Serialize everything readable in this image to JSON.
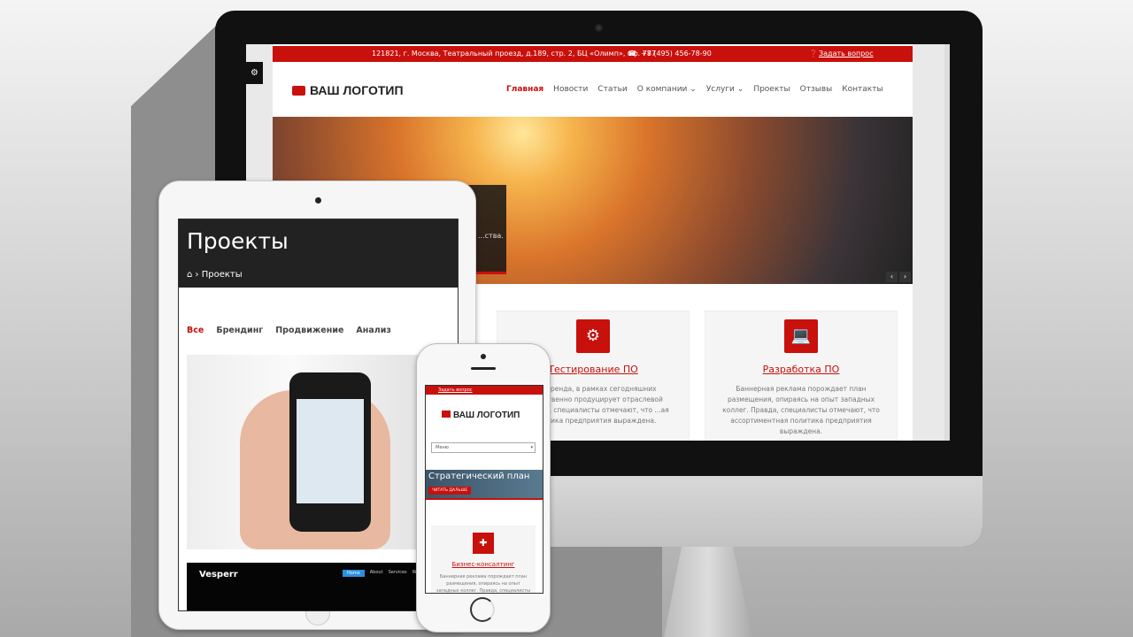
{
  "desktop": {
    "topbar": {
      "address": "121821, г. Москва, Театральный проезд, д.189, стр. 2, БЦ «Олимп», оф. 787",
      "phone": "+7 (495) 456-78-90",
      "ask": "Задать вопрос"
    },
    "logo": "ВАШ ЛОГОТИП",
    "nav": [
      "Главная",
      "Новости",
      "Статьи",
      "О компании ⌄",
      "Услуги ⌄",
      "Проекты",
      "Отзывы",
      "Контакты"
    ],
    "hero_caption": "...ства.",
    "cards": [
      {
        "icon": "gears-icon",
        "title": "Тестирование ПО",
        "text": "...ие бренда, в рамках сегодняшних ...ущественно продуцирует отраслевой ...Правда, специалисты отмечают, что ...ая политика предприятия выраждена."
      },
      {
        "icon": "laptop-icon",
        "title": "Разработка ПО",
        "text": "Баннерная реклама порождает план размещения, опираясь на опыт западных коллег. Правда, специалисты отмечают, что ассортиментная политика предприятия выраждена."
      }
    ]
  },
  "tablet": {
    "title": "Проекты",
    "breadcrumb": "Проекты",
    "filters": [
      "Все",
      "Брендинг",
      "Продвижение",
      "Анализ"
    ],
    "vesperr": {
      "logo": "Vesperr",
      "nav": [
        "Home",
        "About",
        "Services",
        "Works"
      ]
    }
  },
  "phone": {
    "ask": "Задать вопрос",
    "logo": "ВАШ ЛОГОТИП",
    "menu": "Меню",
    "banner_title": "Стратегический план",
    "banner_button": "ЧИТАТЬ ДАЛЬШЕ",
    "card_title": "Бизнес-консалтинг",
    "card_text": "Баннерная реклама порождает план размещения, опираясь на опыт западных коллег. Правда, специалисты отмечают..."
  },
  "colors": {
    "accent": "#c8100c",
    "dark": "#222222"
  }
}
